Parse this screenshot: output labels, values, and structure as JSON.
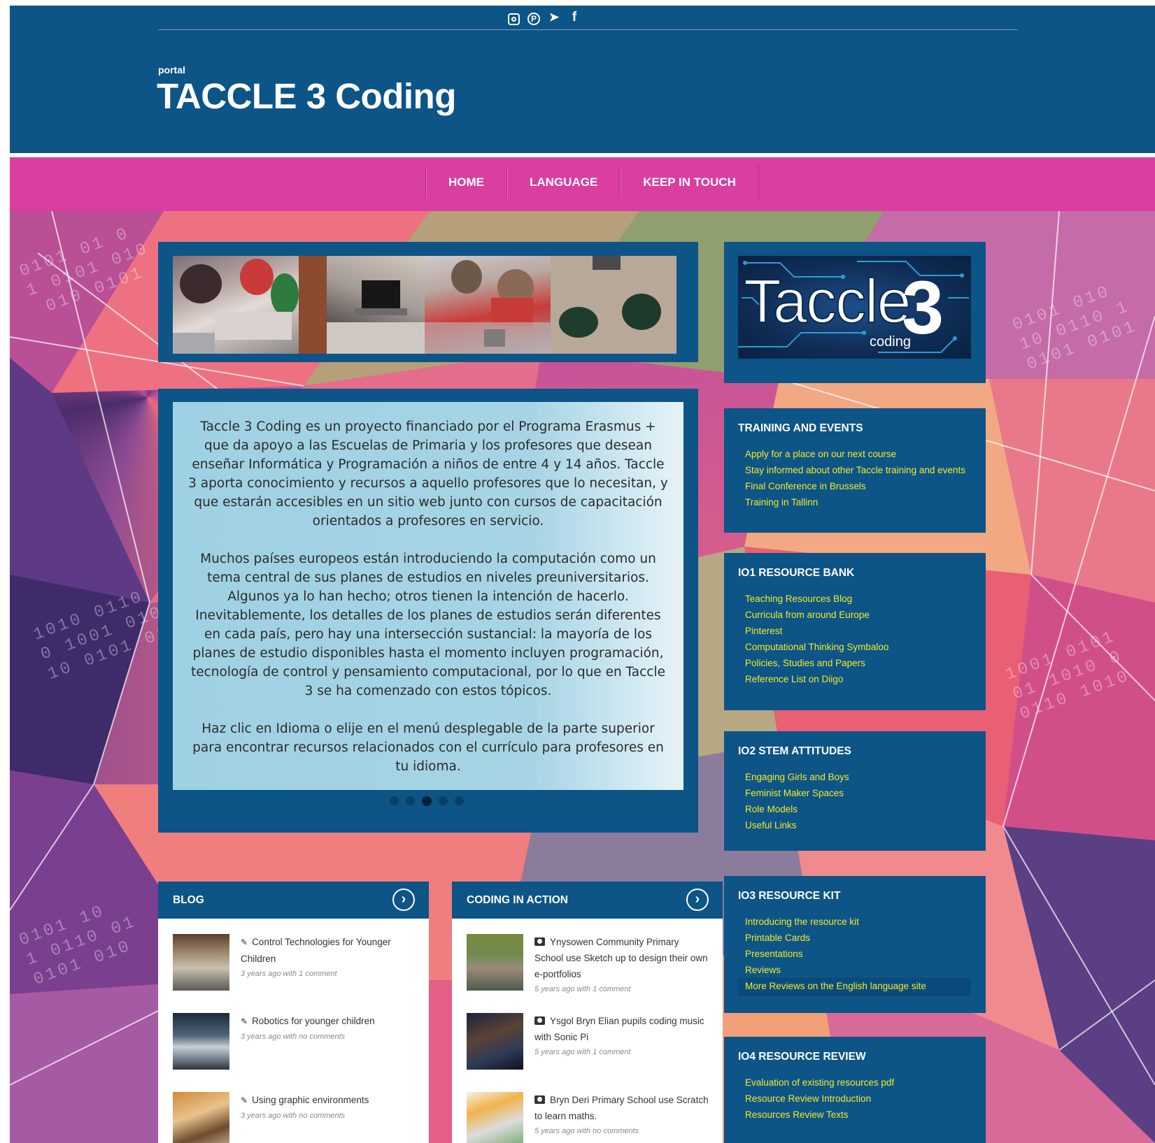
{
  "social": {
    "instagram": "instagram-icon",
    "pinterest": "P",
    "twitter": "🐦",
    "facebook": "f"
  },
  "header": {
    "tagline": "portal",
    "title": "TACCLE 3 Coding"
  },
  "nav": [
    "HOME",
    "LANGUAGE",
    "KEEP IN TOUCH"
  ],
  "logo": {
    "word": "Taccle",
    "number": "3",
    "sub": "coding"
  },
  "intro": {
    "p1": "Taccle 3 Coding es un proyecto financiado por el Programa Erasmus + que da apoyo a las Escuelas de Primaria y los profesores que desean enseñar Informática y Programación a niños de entre 4 y 14 años. Taccle 3 aporta conocimiento y recursos a aquello profesores que lo necesitan, y que estarán accesibles en un sitio web junto con cursos de capacitación orientados a profesores en servicio.",
    "p2": "Muchos países europeos están introduciendo la computación como un tema central de sus planes de estudios en niveles preuniversitarios. Algunos ya lo han hecho; otros tienen la intención de hacerlo. Inevitablemente, los detalles de los planes de estudios serán diferentes en cada país, pero hay una intersección sustancial: la mayoría de los planes de estudio disponibles hasta el momento incluyen programación, tecnología de control y pensamiento computacional, por lo que en Taccle 3 se ha comenzado con estos tópicos.",
    "p3": "Haz clic en Idioma o elije en el menú desplegable de la parte superior para encontrar recursos relacionados con el currículo para profesores en tu idioma."
  },
  "widgets": {
    "training": {
      "title": "TRAINING AND EVENTS",
      "links": [
        "Apply for a place on our next course",
        "Stay informed about other Taccle training and events",
        "Final Conference in Brussels",
        "Training in Tallinn"
      ]
    },
    "io1": {
      "title": "IO1 RESOURCE BANK",
      "links": [
        "Teaching Resources Blog",
        "Curricula from around Europe",
        "Pinterest",
        "Computational Thinking Symbaloo",
        "Policies, Studies and Papers",
        "Reference List on Diigo"
      ]
    },
    "io2": {
      "title": "IO2 STEM ATTITUDES",
      "links": [
        "Engaging Girls and Boys",
        "Feminist Maker Spaces",
        "Role Models",
        "Useful Links"
      ]
    },
    "io3": {
      "title": "IO3 RESOURCE KIT",
      "links": [
        "Introducing the resource kit",
        "Printable Cards",
        "Presentations",
        "Reviews",
        "More Reviews on the English language site"
      ]
    },
    "io4": {
      "title": "IO4 RESOURCE REVIEW",
      "links": [
        "Evaluation of existing resources pdf",
        "Resource Review Introduction",
        "Resources Review Texts"
      ]
    }
  },
  "blog": {
    "title": "BLOG",
    "posts": [
      {
        "title": "Control Technologies for Younger Children",
        "age": "3 years ago with ",
        "comments": "1 comment"
      },
      {
        "title": "Robotics for younger children",
        "age": "3 years ago with ",
        "comments": "no comments"
      },
      {
        "title": "Using graphic environments",
        "age": "3 years ago with ",
        "comments": "no comments"
      }
    ]
  },
  "coding": {
    "title": "CODING IN ACTION",
    "posts": [
      {
        "title": "Ynysowen Community Primary School use Sketch up to design their own e-portfolios",
        "age": "5 years ago with ",
        "comments": "1 comment"
      },
      {
        "title": "Ysgol Bryn Elian pupils coding music with Sonic Pi",
        "age": "5 years ago with ",
        "comments": "1 comment"
      },
      {
        "title": "Bryn Deri Primary School use Scratch to learn maths.",
        "age": "5 years ago with ",
        "comments": "no comments"
      }
    ]
  },
  "colors": {
    "header_blue": "#0d5487",
    "nav_pink": "#d93ea0",
    "link_yellow": "#f4eb29"
  }
}
